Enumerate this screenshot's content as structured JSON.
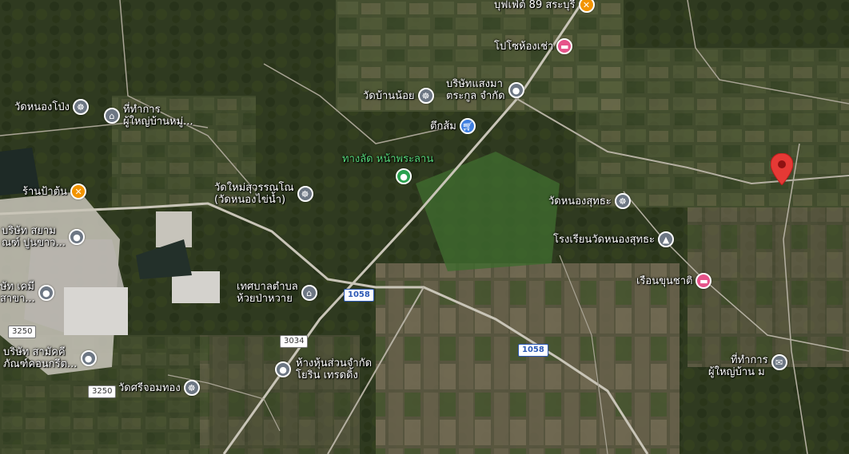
{
  "map": {
    "type": "satellite",
    "colors": {
      "field_dark": "#3f4a2c",
      "road": "#c9c5b8",
      "poi_gray": "#6d7784",
      "poi_pink": "#e6538a",
      "poi_blue": "#3f7fe0",
      "poi_orange": "#f29400",
      "poi_green": "#2aa14f",
      "selected_pin": "#e53935"
    }
  },
  "pois": [
    {
      "id": "buffet",
      "label": "บุฟเฟ่ต์ 89 สระบุรี",
      "icon": "food-icon"
    },
    {
      "id": "popo",
      "label": "โปโซห้องเช่า",
      "icon": "bed-icon"
    },
    {
      "id": "sangma",
      "line1": "บริษัทแสงมา",
      "line2": "ตระกูล จำกัด",
      "icon": "pin-icon"
    },
    {
      "id": "watbannoi",
      "label": "วัดบ้านน้อย",
      "icon": "temple-icon"
    },
    {
      "id": "tuksom",
      "label": "ตึกส้ม",
      "icon": "cart-icon"
    },
    {
      "id": "shortcut",
      "label": "ทางลัด หน้าพระลาน",
      "icon": "pin-icon"
    },
    {
      "id": "watnongpong",
      "label": "วัดหนองโป่ง",
      "icon": "temple-icon"
    },
    {
      "id": "office1",
      "line1": "ที่ทำการ",
      "line2": "ผู้ใหญ่บ้านหมู่...",
      "icon": "government-icon"
    },
    {
      "id": "ranpaton",
      "label": "ร้านป้าต้น",
      "icon": "food-icon"
    },
    {
      "id": "watmai",
      "line1": "วัดใหม่สุวรรณโณ",
      "line2": "(วัดหนองไข่น้ำ)",
      "icon": "temple-icon"
    },
    {
      "id": "siam",
      "line1": "บริษัท สยาม",
      "line2": "ณฑ์ ปูนขาว...",
      "icon": "pin-icon"
    },
    {
      "id": "chemi",
      "line1": "ษัท เคมี",
      "line2": "สาขา...",
      "icon": "pin-icon"
    },
    {
      "id": "samakkhi",
      "line1": "บริษัท สามัคคี",
      "line2": "ภัณฑ์คอนกรีต...",
      "icon": "pin-icon"
    },
    {
      "id": "watnongsuthra",
      "label": "วัดหนองสุทธะ",
      "icon": "temple-icon"
    },
    {
      "id": "school",
      "label": "โรงเรียนวัดหนองสุทธะ",
      "icon": "school-icon"
    },
    {
      "id": "ruenkhun",
      "label": "เรือนขุนชาติ",
      "icon": "bed-icon"
    },
    {
      "id": "tessaban",
      "line1": "เทศบาลตำบล",
      "line2": "ห้วยป่าหวาย",
      "icon": "government-icon"
    },
    {
      "id": "yorin",
      "line1": "ห้างหุ้นส่วนจำกัด",
      "line2": "โยริน เทรดดิ้ง",
      "icon": "pin-icon"
    },
    {
      "id": "watsrijom",
      "label": "วัดศรีจอมทอง",
      "icon": "temple-icon"
    },
    {
      "id": "office2",
      "line1": "ที่ทำการ",
      "line2": "ผู้ใหญ่บ้าน ม",
      "icon": "mail-icon"
    }
  ],
  "routes": {
    "r1058a": "1058",
    "r1058b": "1058",
    "r3034": "3034",
    "r3250a": "3250",
    "r3250b": "3250"
  }
}
